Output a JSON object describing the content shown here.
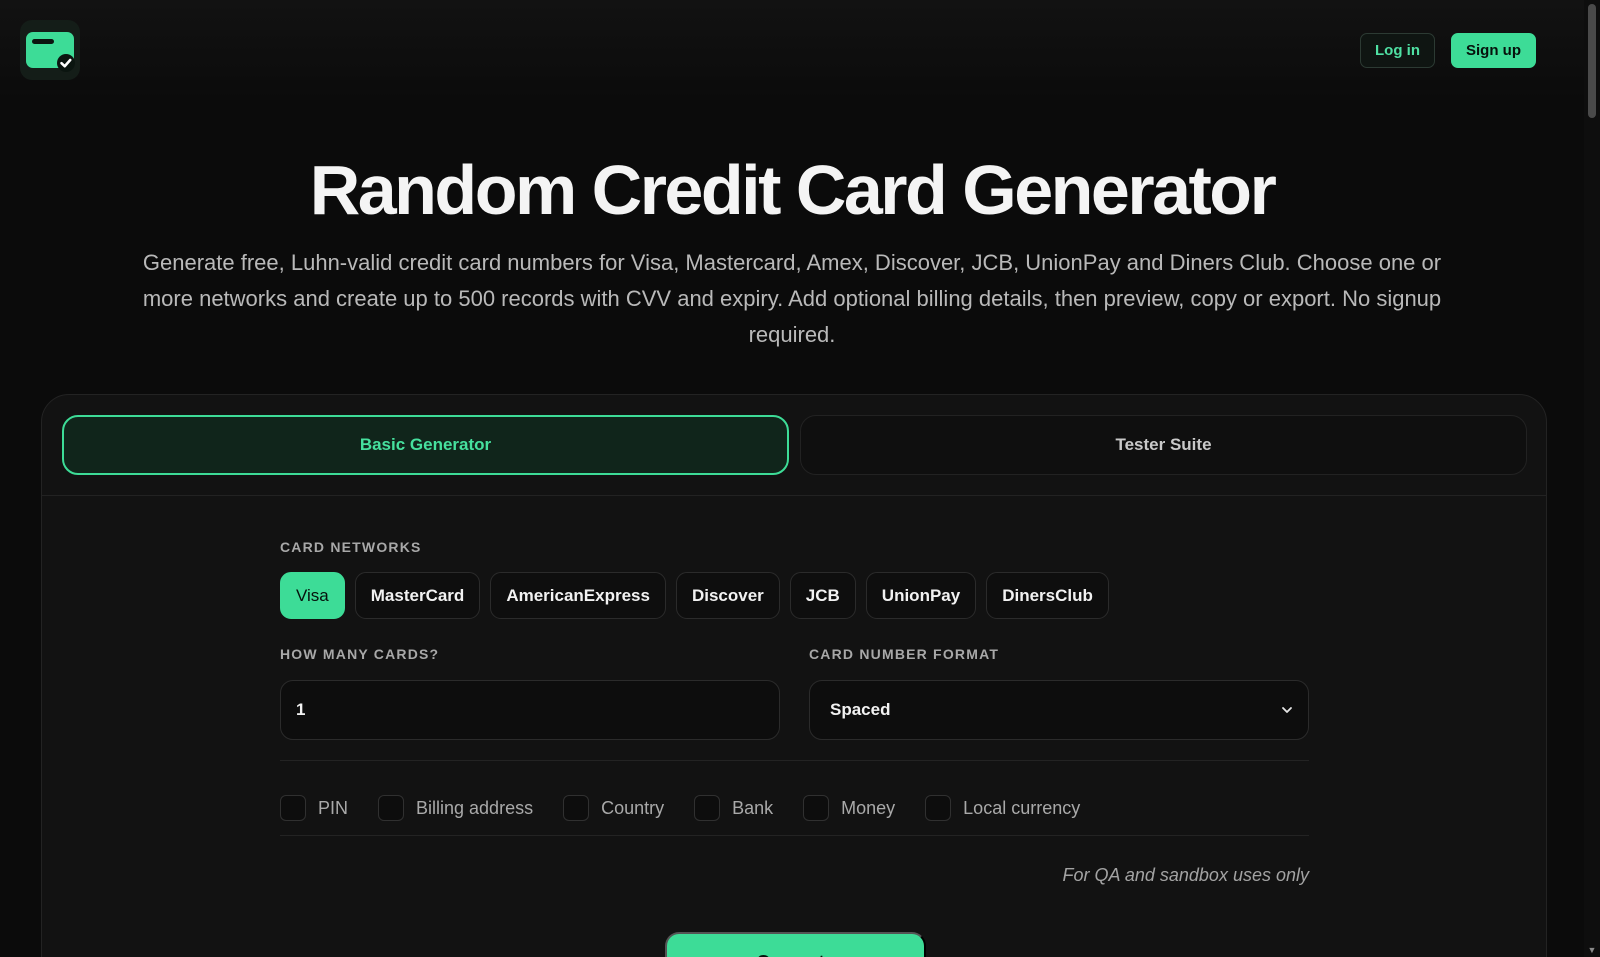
{
  "header": {
    "logo_icon": "card-check-icon",
    "login_label": "Log in",
    "signup_label": "Sign up"
  },
  "hero": {
    "title": "Random Credit Card Generator",
    "subtitle": "Generate free, Luhn-valid credit card numbers for Visa, Mastercard, Amex, Discover, JCB, UnionPay and Diners Club. Choose one or more networks and create up to 500 records with CVV and expiry. Add optional billing details, then preview, copy or export. No signup required."
  },
  "tabs": [
    {
      "label": "Basic Generator",
      "active": true
    },
    {
      "label": "Tester Suite",
      "active": false
    }
  ],
  "form": {
    "networks_label": "CARD NETWORKS",
    "networks": [
      {
        "label": "Visa",
        "selected": true
      },
      {
        "label": "MasterCard",
        "selected": false
      },
      {
        "label": "AmericanExpress",
        "selected": false
      },
      {
        "label": "Discover",
        "selected": false
      },
      {
        "label": "JCB",
        "selected": false
      },
      {
        "label": "UnionPay",
        "selected": false
      },
      {
        "label": "DinersClub",
        "selected": false
      }
    ],
    "count_label": "HOW MANY CARDS?",
    "count_value": "1",
    "format_label": "CARD NUMBER FORMAT",
    "format_value": "Spaced",
    "options": [
      {
        "label": "PIN",
        "checked": false
      },
      {
        "label": "Billing address",
        "checked": false
      },
      {
        "label": "Country",
        "checked": false
      },
      {
        "label": "Bank",
        "checked": false
      },
      {
        "label": "Money",
        "checked": false
      },
      {
        "label": "Local currency",
        "checked": false
      }
    ],
    "note": "For QA and sandbox uses only",
    "generate_label": "Generate"
  },
  "colors": {
    "background": "#0b0b0b",
    "accent": "#3ddc97",
    "panel": "#121212"
  }
}
